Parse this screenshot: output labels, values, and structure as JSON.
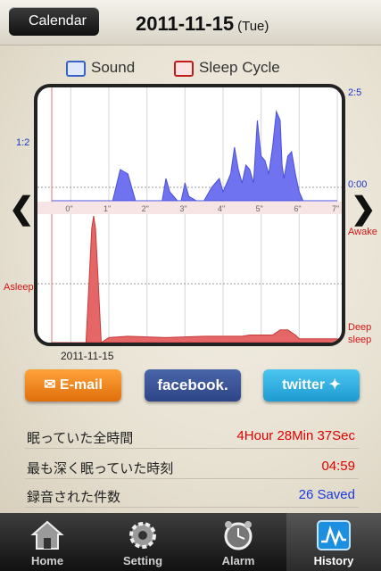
{
  "header": {
    "back_label": "Calendar",
    "date": "2011-11-15",
    "weekday": "(Tue)"
  },
  "legend": {
    "sound": "Sound",
    "sleep": "Sleep Cycle"
  },
  "chart_labels": {
    "sound_top": "2:5",
    "sound_mid": "1:2",
    "sound_zero": "0:00",
    "awake": "Awake",
    "asleep": "Asleep",
    "deep_sleep_1": "Deep",
    "deep_sleep_2": "sleep",
    "chart_date": "2011-11-15"
  },
  "chart_data": [
    {
      "type": "area",
      "series": [
        {
          "name": "Sound",
          "color": "#6f73f0"
        }
      ],
      "x_ticks": [
        "0\"",
        "1\"",
        "2\"",
        "3\"",
        "4\"",
        "5\"",
        "6\"",
        "7\""
      ],
      "x": [
        0,
        0.5,
        1,
        1.6,
        1.8,
        2,
        2.2,
        2.4,
        2.8,
        2.9,
        3.0,
        3.1,
        3.3,
        3.4,
        3.5,
        3.6,
        3.8,
        4.0,
        4.2,
        4.4,
        4.5,
        4.6,
        4.7,
        4.8,
        4.9,
        5.0,
        5.1,
        5.2,
        5.3,
        5.4,
        5.5,
        5.6,
        5.7,
        5.8,
        5.9,
        6.0,
        6.05,
        6.1,
        6.2,
        6.3,
        6.4,
        6.5,
        6.6,
        7.0,
        7.5
      ],
      "values": [
        0,
        0,
        0,
        0,
        0.35,
        0.3,
        0,
        0,
        0,
        0,
        0.25,
        0.1,
        0,
        0,
        0.2,
        0.05,
        0,
        0,
        0.15,
        0.25,
        0.1,
        0.2,
        0.3,
        0.6,
        0.35,
        0.2,
        0.4,
        0.35,
        0.2,
        0.9,
        0.5,
        0.45,
        0.3,
        0.6,
        1.0,
        0.9,
        0.4,
        0.25,
        0.5,
        0.55,
        0.3,
        0.1,
        0,
        0,
        0
      ]
    },
    {
      "type": "area",
      "series": [
        {
          "name": "Sleep Cycle",
          "color": "#e56666"
        }
      ],
      "x": [
        0,
        0.9,
        1.05,
        1.1,
        1.15,
        1.3,
        1.5,
        2.0,
        3.0,
        4.0,
        5.0,
        5.2,
        5.8,
        6.0,
        6.2,
        6.4,
        6.5,
        7.5
      ],
      "values": [
        0,
        0,
        0.9,
        1.0,
        0.9,
        0,
        0.04,
        0.05,
        0.04,
        0.05,
        0.05,
        0.06,
        0.06,
        0.1,
        0.1,
        0.06,
        0.03,
        0.03
      ]
    }
  ],
  "share": {
    "email": "E-mail",
    "facebook": "facebook.",
    "twitter": "twitter"
  },
  "info": [
    {
      "label": "眠っていた全時間",
      "value": "4Hour 28Min 37Sec",
      "color": "#e00000"
    },
    {
      "label": "最も深く眠っていた時刻",
      "value": "04:59",
      "color": "#e00000"
    },
    {
      "label": "録音された件数",
      "value": "26 Saved",
      "color": "#1a3ae0"
    }
  ],
  "tabs": [
    {
      "label": "Home",
      "icon": "home-icon"
    },
    {
      "label": "Setting",
      "icon": "gear-icon"
    },
    {
      "label": "Alarm",
      "icon": "alarm-clock-icon"
    },
    {
      "label": "History",
      "icon": "history-chart-icon"
    }
  ]
}
